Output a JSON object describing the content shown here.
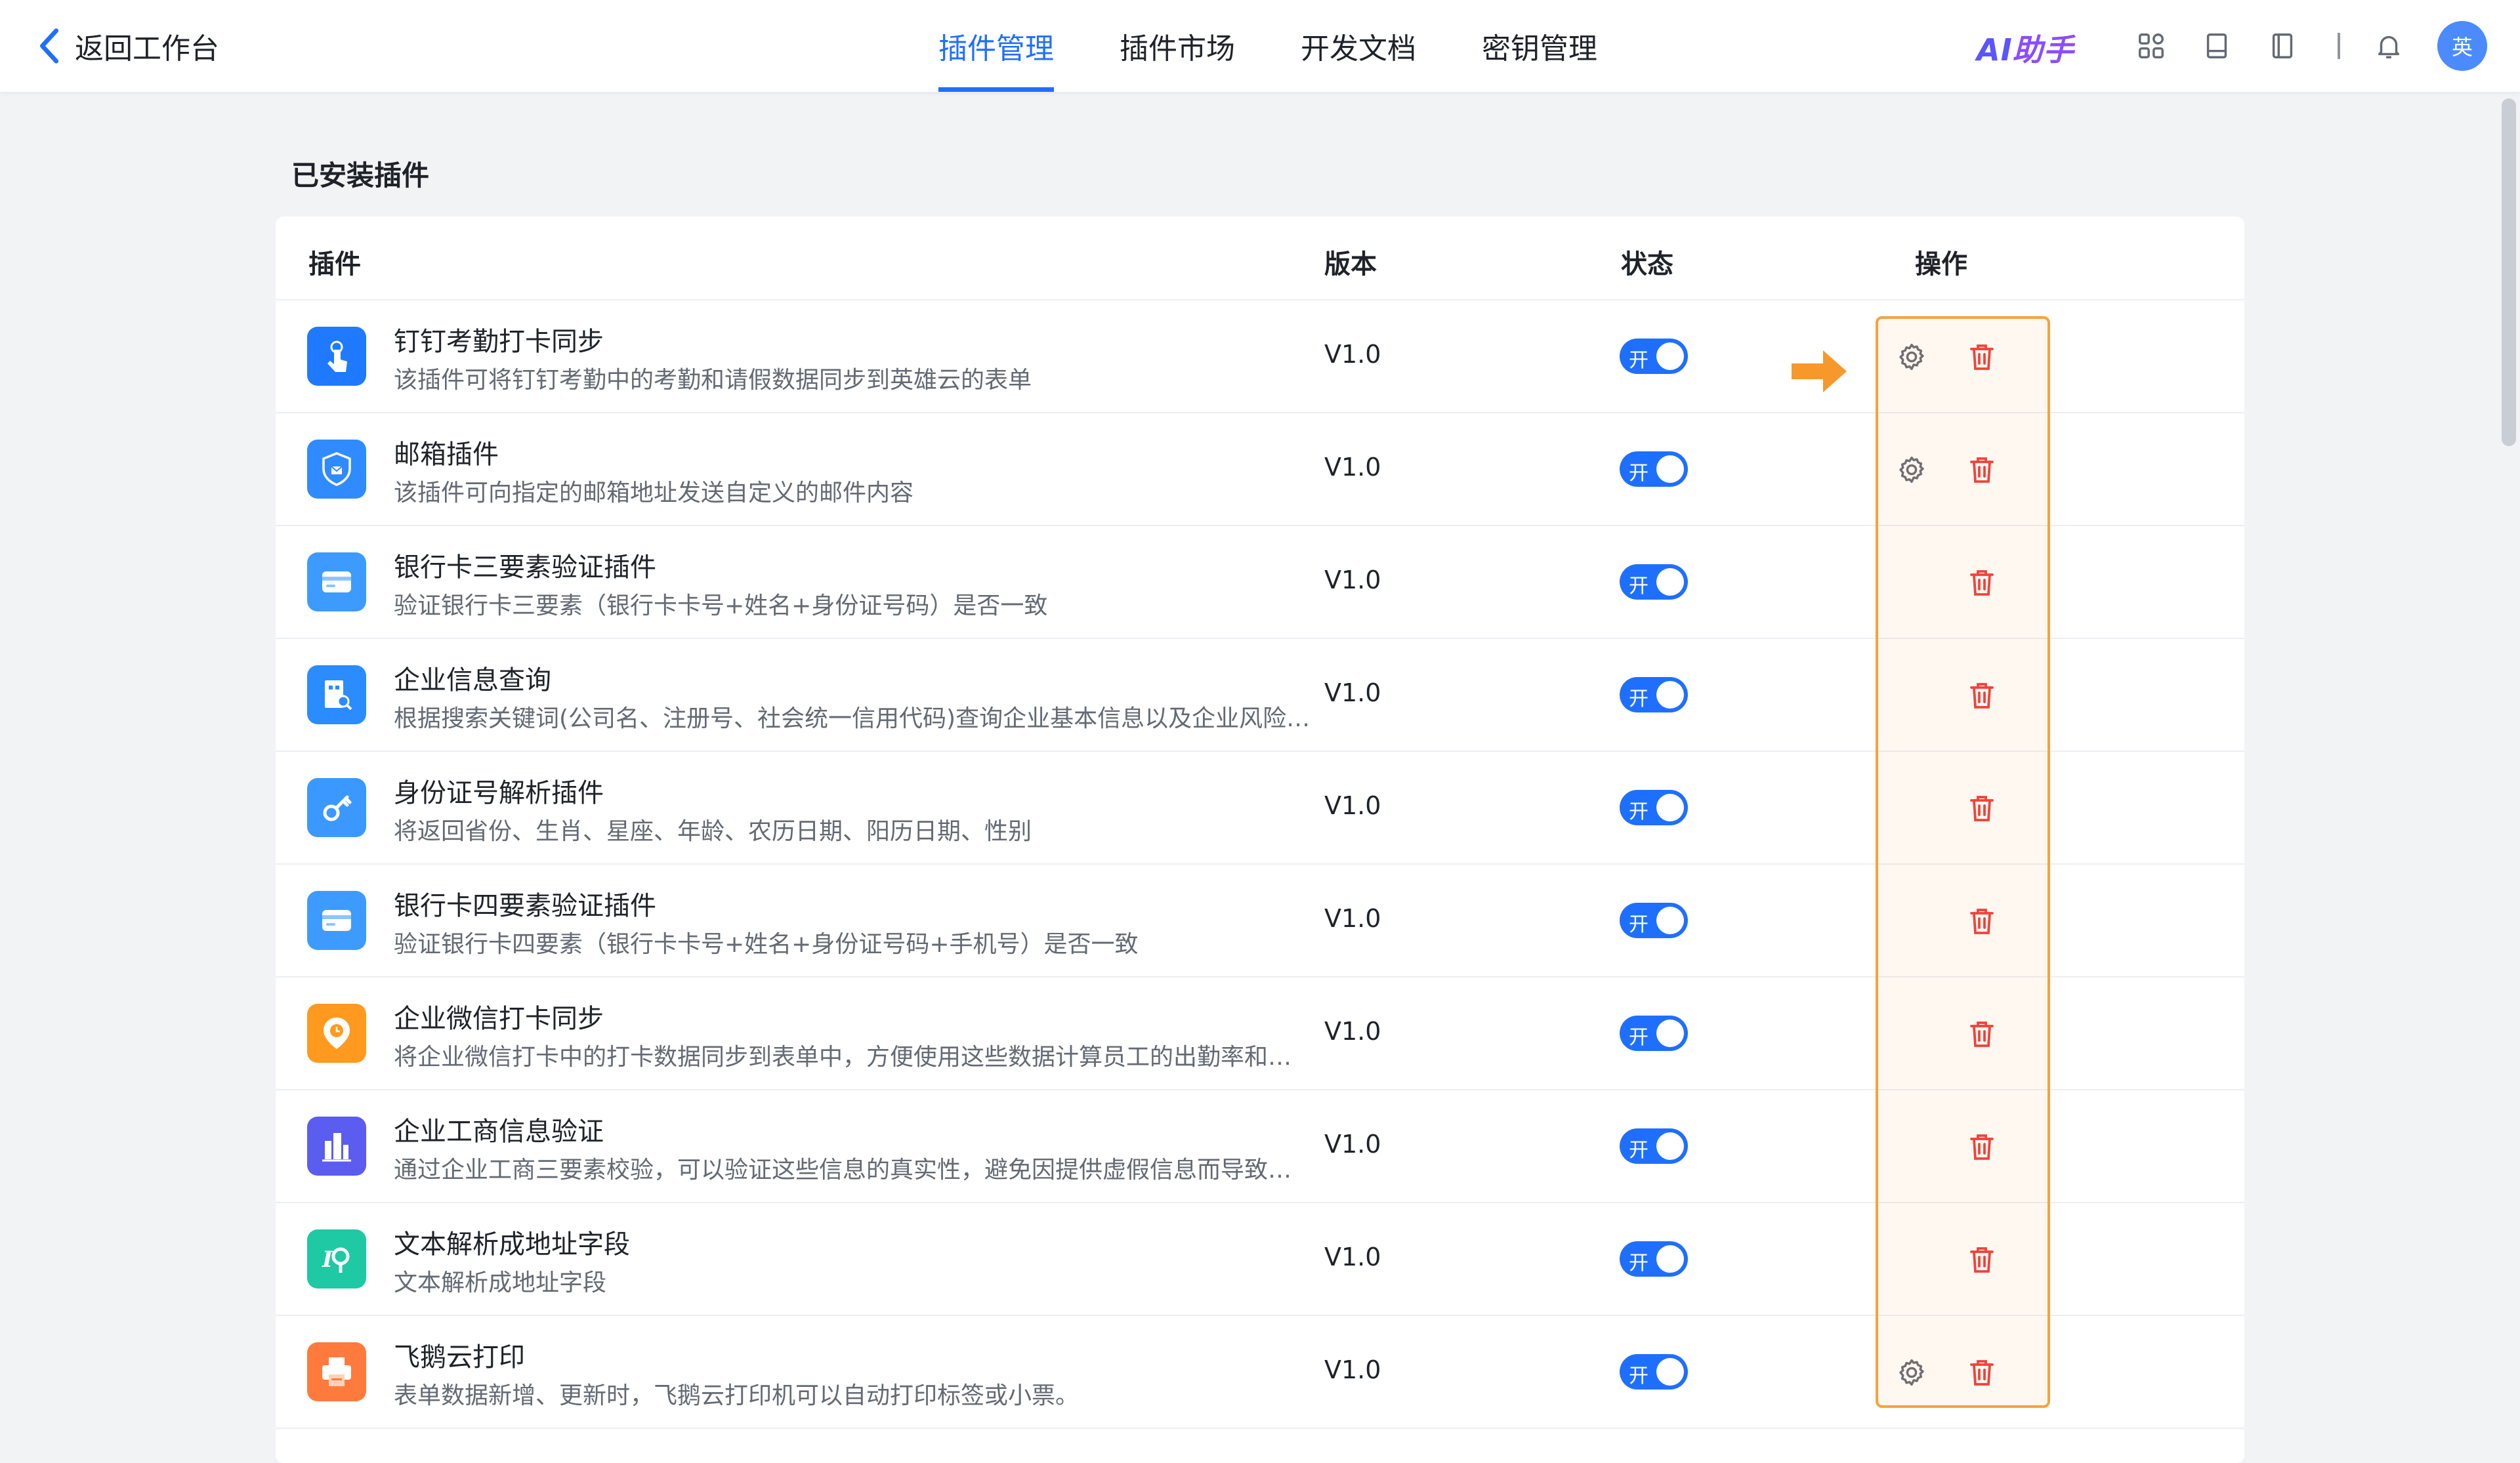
{
  "header": {
    "back_label": "返回工作台",
    "tabs": [
      {
        "label": "插件管理",
        "active": true
      },
      {
        "label": "插件市场",
        "active": false
      },
      {
        "label": "开发文档",
        "active": false
      },
      {
        "label": "密钥管理",
        "active": false
      }
    ],
    "ai_logo_ai": "AI",
    "ai_logo_rest": "助手",
    "icons": [
      "apps-icon",
      "book-icon",
      "notebook-icon",
      "bell-icon"
    ],
    "avatar_text": "英"
  },
  "section_title": "已安装插件",
  "table": {
    "columns": [
      "插件",
      "版本",
      "状态",
      "操作"
    ],
    "toggle_label": "开",
    "rows": [
      {
        "name": "钉钉考勤打卡同步",
        "desc": "该插件可将钉钉考勤中的考勤和请假数据同步到英雄云的表单",
        "version": "V1.0",
        "enabled": true,
        "has_settings": true,
        "icon": "touch-icon",
        "color": "#1f7aff"
      },
      {
        "name": "邮箱插件",
        "desc": "该插件可向指定的邮箱地址发送自定义的邮件内容",
        "version": "V1.0",
        "enabled": true,
        "has_settings": true,
        "icon": "mail-shield-icon",
        "color": "#2f8bff"
      },
      {
        "name": "银行卡三要素验证插件",
        "desc": "验证银行卡三要素（银行卡卡号+姓名+身份证号码）是否一致",
        "version": "V1.0",
        "enabled": true,
        "has_settings": false,
        "icon": "bank-card-icon",
        "color": "#3d9bff"
      },
      {
        "name": "企业信息查询",
        "desc": "根据搜索关键词(公司名、注册号、社会统一信用代码)查询企业基本信息以及企业风险信息",
        "version": "V1.0",
        "enabled": true,
        "has_settings": false,
        "icon": "company-search-icon",
        "color": "#2a8cff"
      },
      {
        "name": "身份证号解析插件",
        "desc": "将返回省份、生肖、星座、年龄、农历日期、阳历日期、性别",
        "version": "V1.0",
        "enabled": true,
        "has_settings": false,
        "icon": "key-icon",
        "color": "#3b98ff"
      },
      {
        "name": "银行卡四要素验证插件",
        "desc": "验证银行卡四要素（银行卡卡号+姓名+身份证号码+手机号）是否一致",
        "version": "V1.0",
        "enabled": true,
        "has_settings": false,
        "icon": "bank-card-icon",
        "color": "#3d9bff"
      },
      {
        "name": "企业微信打卡同步",
        "desc": "将企业微信打卡中的打卡数据同步到表单中，方便使用这些数据计算员工的出勤率和工作时长",
        "version": "V1.0",
        "enabled": true,
        "has_settings": false,
        "icon": "clock-pin-icon",
        "color": "#ff9a1f"
      },
      {
        "name": "企业工商信息验证",
        "desc": "通过企业工商三要素校验，可以验证这些信息的真实性，避免因提供虚假信息而导致的风险",
        "version": "V1.0",
        "enabled": true,
        "has_settings": false,
        "icon": "building-icon",
        "color": "#5b5cf0"
      },
      {
        "name": "文本解析成地址字段",
        "desc": "文本解析成地址字段",
        "version": "V1.0",
        "enabled": true,
        "has_settings": false,
        "icon": "text-location-icon",
        "color": "#1ec9a4"
      },
      {
        "name": "飞鹅云打印",
        "desc": "表单数据新增、更新时，飞鹅云打印机可以自动打印标签或小票。",
        "version": "V1.0",
        "enabled": true,
        "has_settings": true,
        "icon": "printer-icon",
        "color": "#ff7a3d"
      }
    ]
  },
  "colors": {
    "accent": "#1f6fff",
    "delete": "#f03a3a",
    "highlight": "#f7a23b"
  }
}
